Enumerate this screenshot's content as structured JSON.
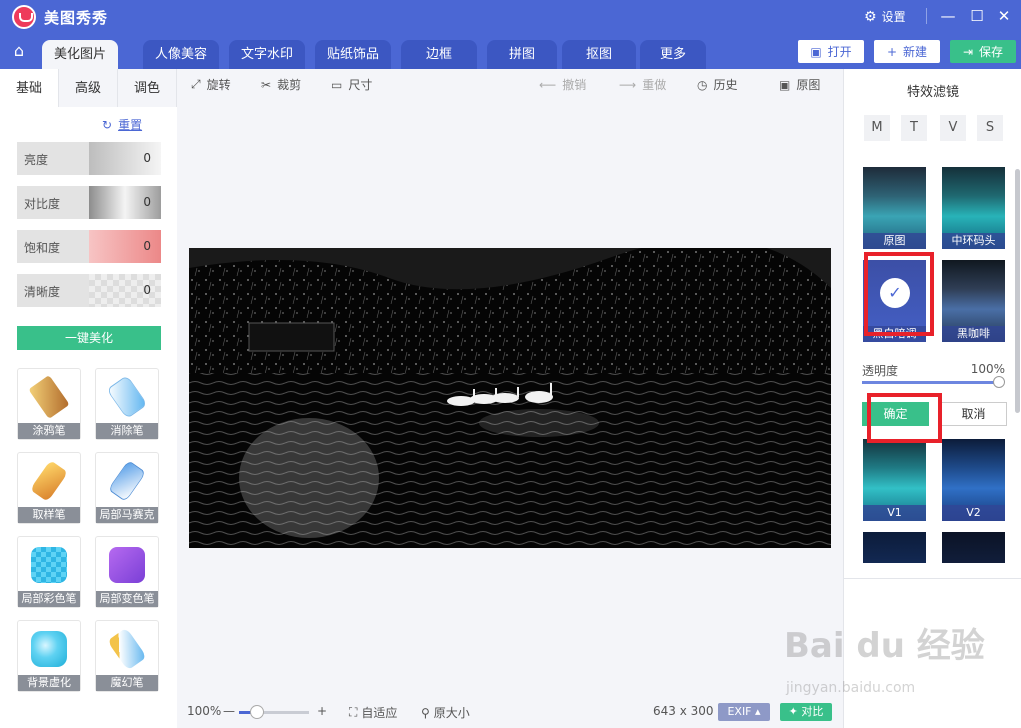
{
  "app": {
    "title": "美图秀秀",
    "settings_label": "设置",
    "minimize": "—",
    "maximize": "☐",
    "close": "✕"
  },
  "nav": {
    "tabs": [
      {
        "label": "美化图片"
      },
      {
        "label": "人像美容"
      },
      {
        "label": "文字水印"
      },
      {
        "label": "贴纸饰品"
      },
      {
        "label": "边框"
      },
      {
        "label": "拼图"
      },
      {
        "label": "抠图"
      },
      {
        "label": "更多"
      }
    ],
    "open_label": "打开",
    "new_label": "新建",
    "save_label": "保存"
  },
  "left": {
    "subtabs": [
      {
        "label": "基础"
      },
      {
        "label": "高级"
      },
      {
        "label": "调色"
      }
    ],
    "reset_label": "重置",
    "sliders": [
      {
        "label": "亮度",
        "value": "0"
      },
      {
        "label": "对比度",
        "value": "0"
      },
      {
        "label": "饱和度",
        "value": "0"
      },
      {
        "label": "清晰度",
        "value": "0"
      }
    ],
    "onekey_label": "一键美化",
    "tools": [
      {
        "label": "涂鸦笔"
      },
      {
        "label": "消除笔"
      },
      {
        "label": "取样笔"
      },
      {
        "label": "局部马赛克"
      },
      {
        "label": "局部彩色笔"
      },
      {
        "label": "局部变色笔"
      },
      {
        "label": "背景虚化"
      },
      {
        "label": "魔幻笔"
      }
    ]
  },
  "toolbar": {
    "rotate": "旋转",
    "crop": "裁剪",
    "size": "尺寸",
    "undo": "撤销",
    "redo": "重做",
    "history": "历史",
    "original": "原图"
  },
  "bottom": {
    "zoom": "100%",
    "fit": "自适应",
    "actual": "原大小",
    "dimensions": "643 x 300",
    "exif": "EXIF",
    "compare": "对比"
  },
  "right": {
    "title": "特效滤镜",
    "categories": [
      {
        "label": "M"
      },
      {
        "label": "T"
      },
      {
        "label": "V"
      },
      {
        "label": "S"
      }
    ],
    "filters": [
      {
        "label": "原图"
      },
      {
        "label": "中环码头"
      },
      {
        "label": "黑白暗调"
      },
      {
        "label": "黑咖啡"
      },
      {
        "label": "V1"
      },
      {
        "label": "V2"
      }
    ],
    "opacity_label": "透明度",
    "opacity_value": "100%",
    "ok_label": "确定",
    "cancel_label": "取消"
  },
  "watermark": {
    "text": "Bai du 经验",
    "sub": "jingyan.baidu.com"
  }
}
